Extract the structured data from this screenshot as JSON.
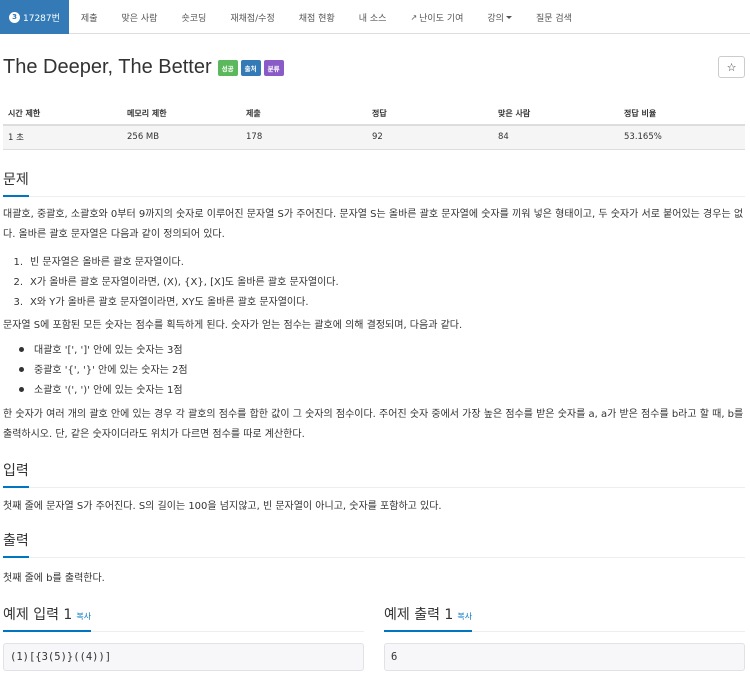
{
  "nav": {
    "problem_number": "17287번",
    "badge": "3",
    "items": [
      "제출",
      "맞은 사람",
      "숏코딩",
      "재채점/수정",
      "채점 현황",
      "내 소스",
      "난이도 기여",
      "강의",
      "질문 검색"
    ]
  },
  "title": "The Deeper, The Better",
  "labels": [
    "성공",
    "출처",
    "분류"
  ],
  "star": "☆",
  "table": {
    "headers": [
      "시간 제한",
      "메모리 제한",
      "제출",
      "정답",
      "맞은 사람",
      "정답 비율"
    ],
    "values": [
      "1 초",
      "256 MB",
      "178",
      "92",
      "84",
      "53.165%"
    ]
  },
  "sections": {
    "problem": "문제",
    "input": "입력",
    "output": "출력",
    "sample_input": "예제 입력 1",
    "sample_output": "예제 출력 1",
    "copy": "복사"
  },
  "problem": {
    "p1": "대괄호, 중괄호, 소괄호와 0부터 9까지의 숫자로 이루어진 문자열 S가 주어진다. 문자열 S는 올바른 괄호 문자열에 숫자를 끼워 넣은 형태이고, 두 숫자가 서로 붙어있는 경우는 없다. 올바른 괄호 문자열은 다음과 같이 정의되어 있다.",
    "ol": [
      "빈 문자열은 올바른 괄호 문자열이다.",
      "X가 올바른 괄호 문자열이라면, (X), {X}, [X]도 올바른 괄호 문자열이다.",
      "X와 Y가 올바른 괄호 문자열이라면, XY도 올바른 괄호 문자열이다."
    ],
    "p2": "문자열 S에 포함된 모든 숫자는 점수를 획득하게 된다. 숫자가 얻는 점수는 괄호에 의해 결정되며, 다음과 같다.",
    "ul": [
      "대괄호 '[', ']' 안에 있는 숫자는 3점",
      "중괄호 '{', '}' 안에 있는 숫자는 2점",
      "소괄호 '(', ')' 안에 있는 숫자는 1점"
    ],
    "p3": "한 숫자가 여러 개의 괄호 안에 있는 경우 각 괄호의 점수를 합한 값이 그 숫자의 점수이다. 주어진 숫자 중에서 가장 높은 점수를 받은 숫자를 a, a가 받은 점수를 b라고 할 때, b를 출력하시오. 단, 같은 숫자이더라도 위치가 다르면 점수를 따로 계산한다."
  },
  "input_text": "첫째 줄에 문자열 S가 주어진다. S의 길이는 100을 넘지않고, 빈 문자열이 아니고, 숫자를 포함하고 있다.",
  "output_text": "첫째 줄에 b를 출력한다.",
  "sample_input": "(1)[{3(5)}((4))]",
  "sample_output": "6"
}
